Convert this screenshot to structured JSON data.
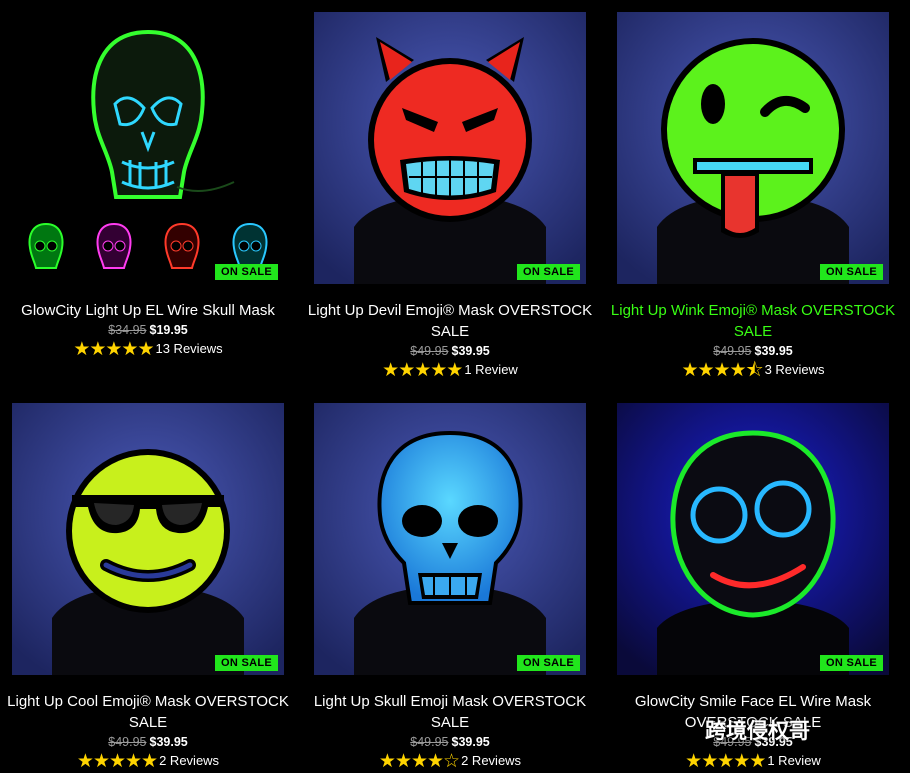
{
  "products": [
    {
      "title": "GlowCity Light Up EL Wire Skull Mask",
      "old_price": "$34.95",
      "new_price": "$19.95",
      "stars": "★★★★★",
      "reviews": "13 Reviews",
      "badge": "ON SALE"
    },
    {
      "title": "Light Up Devil Emoji® Mask OVERSTOCK SALE",
      "old_price": "$49.95",
      "new_price": "$39.95",
      "stars": "★★★★★",
      "reviews": "1 Review",
      "badge": "ON SALE"
    },
    {
      "title": "Light Up Wink Emoji® Mask OVERSTOCK SALE",
      "old_price": "$49.95",
      "new_price": "$39.95",
      "stars": "★★★★⯪",
      "reviews": "3 Reviews",
      "badge": "ON SALE"
    },
    {
      "title": "Light Up Cool Emoji® Mask OVERSTOCK SALE",
      "old_price": "$49.95",
      "new_price": "$39.95",
      "stars": "★★★★★",
      "reviews": "2 Reviews",
      "badge": "ON SALE"
    },
    {
      "title": "Light Up Skull Emoji Mask OVERSTOCK SALE",
      "old_price": "$49.95",
      "new_price": "$39.95",
      "stars": "★★★★☆",
      "reviews": "2 Reviews",
      "badge": "ON SALE"
    },
    {
      "title": "GlowCity Smile Face EL Wire Mask OVERSTOCK SALE",
      "old_price": "$49.95",
      "new_price": "$39.95",
      "stars": "★★★★★",
      "reviews": "1 Review",
      "badge": "ON SALE"
    }
  ],
  "ratings": [
    5,
    5,
    4.5,
    5,
    4,
    5
  ],
  "skull_thumbnail_colors": [
    "#2bff2b",
    "#ff3cf0",
    "#ff3a2a",
    "#29c8ff"
  ],
  "highlight_color": "#39ff14",
  "badge_color": "#21e61c",
  "watermark": "跨境侵权哥"
}
